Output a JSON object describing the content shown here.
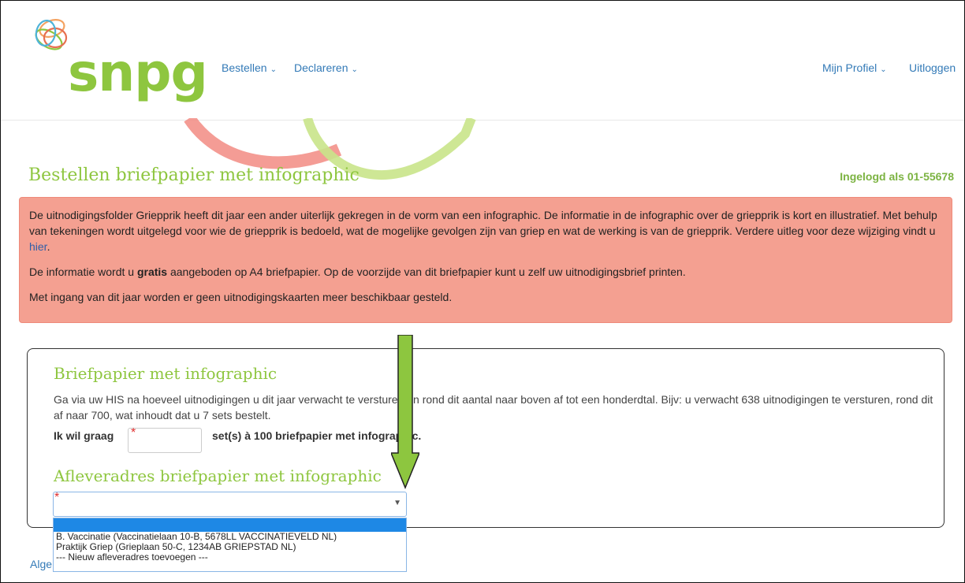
{
  "header": {
    "logo_text": "snpg",
    "nav": {
      "bestellen": "Bestellen",
      "declareren": "Declareren",
      "profiel": "Mijn Profiel",
      "uitloggen": "Uitloggen"
    }
  },
  "page": {
    "title": "Bestellen briefpapier met infographic",
    "logged_in": "Ingelogd als 01-55678"
  },
  "alert": {
    "p1_text": "De uitnodigingsfolder Griepprik heeft dit jaar een ander uiterlijk gekregen in de vorm van een infographic. De informatie in de infographic over de griepprik is kort en illustratief. Met behulp van tekeningen wordt uitgelegd voor wie de griepprik is bedoeld, wat de mogelijke gevolgen zijn van griep en wat de werking is van de griepprik. Verdere uitleg voor deze wijziging vindt u ",
    "p1_link": "hier",
    "p1_end": ".",
    "p2_before": "De informatie wordt u ",
    "p2_bold": "gratis",
    "p2_after": " aangeboden op A4 briefpapier. Op de voorzijde van dit briefpapier kunt u zelf uw uitnodigingsbrief printen.",
    "p3": "Met ingang van dit jaar worden er geen uitnodigingskaarten meer beschikbaar gesteld."
  },
  "form": {
    "section_title": "Briefpapier met infographic",
    "description": "Ga via uw HIS na hoeveel uitnodigingen u dit jaar verwacht te versturen en rond dit aantal naar boven af tot een honderdtal. Bijv: u verwacht 638 uitnodigingen te versturen, rond dit af naar 700, wat inhoudt dat u 7 sets bestelt.",
    "order_label": "Ik wil graag",
    "order_suffix": "set(s) à 100 briefpapier met infographic.",
    "quantity_value": "",
    "required_mark": "*",
    "address_title": "Afleveradres briefpapier met infographic",
    "address_selected": "",
    "address_options": [
      "",
      "B. Vaccinatie (Vaccinatielaan 10-B, 5678LL VACCINATIEVELD NL)",
      "Praktijk Griep (Grieplaan 50-C, 1234AB GRIEPSTAD NL)",
      "--- Nieuw afleveradres toevoegen ---"
    ]
  },
  "footer": {
    "link_text": "Alge"
  },
  "colors": {
    "brand_green": "#8ec63f",
    "alert_bg": "#f4a091",
    "link": "#337ab7",
    "highlight": "#1e88e5",
    "arrow": "#8dc63f"
  },
  "icons": {
    "caret": "chevron-down-icon",
    "select_arrow": "triangle-down-icon"
  }
}
